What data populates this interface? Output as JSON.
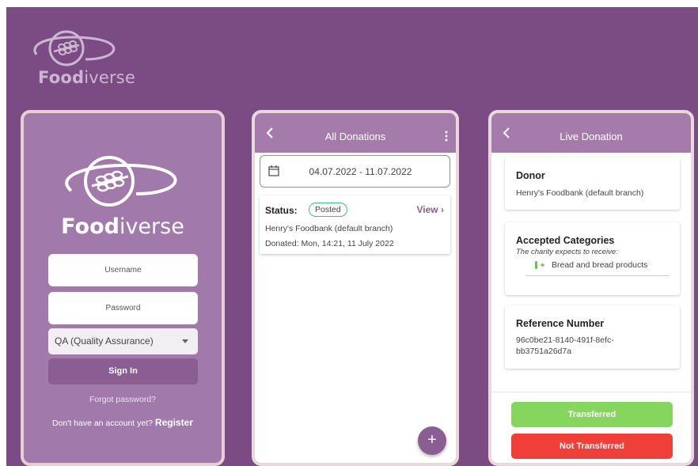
{
  "brand": {
    "bold": "Food",
    "light": "iverse"
  },
  "login": {
    "logo_bold": "Food",
    "logo_light": "iverse",
    "username_placeholder": "Username",
    "password_placeholder": "Password",
    "role_selected": "QA (Quality Assurance)",
    "signin_label": "Sign In",
    "forgot_label": "Forgot password?",
    "no_account_text": "Don't have an account yet?",
    "register_label": "Register"
  },
  "donations": {
    "title": "All Donations",
    "date_range": "04.07.2022 - 11.07.2022",
    "card": {
      "status_label": "Status:",
      "status_value": "Posted",
      "view_label": "View",
      "branch": "Henry's Foodbank (default branch)",
      "donated": "Donated: Mon, 14:21, 11 July 2022"
    },
    "fab_label": "+"
  },
  "live": {
    "title": "Live Donation",
    "donor_heading": "Donor",
    "donor_value": "Henry's Foodbank (default branch)",
    "categories_heading": "Accepted Categories",
    "categories_subtitle": "The charity expects to receive:",
    "categories": [
      "Bread and bread products"
    ],
    "reference_heading": "Reference Number",
    "reference_line1": "96c0be21-8140-491f-8efc-",
    "reference_line2": "bb3751a26d7a",
    "transferred_label": "Transferred",
    "not_transferred_label": "Not Transferred"
  },
  "colors": {
    "background": "#7a4c83",
    "brand_purple": "#8a5d93",
    "appbar": "#a57bac",
    "login_panel": "#a17aab",
    "success": "#86d55f",
    "danger": "#ef3f38",
    "badge_border": "#3fbf7a"
  },
  "icons": [
    "logo-orbit-wheat-icon",
    "back-chevron-icon",
    "kebab-menu-icon",
    "calendar-icon",
    "chevron-right-icon",
    "bread-category-icon",
    "plus-icon",
    "caret-down-icon"
  ]
}
